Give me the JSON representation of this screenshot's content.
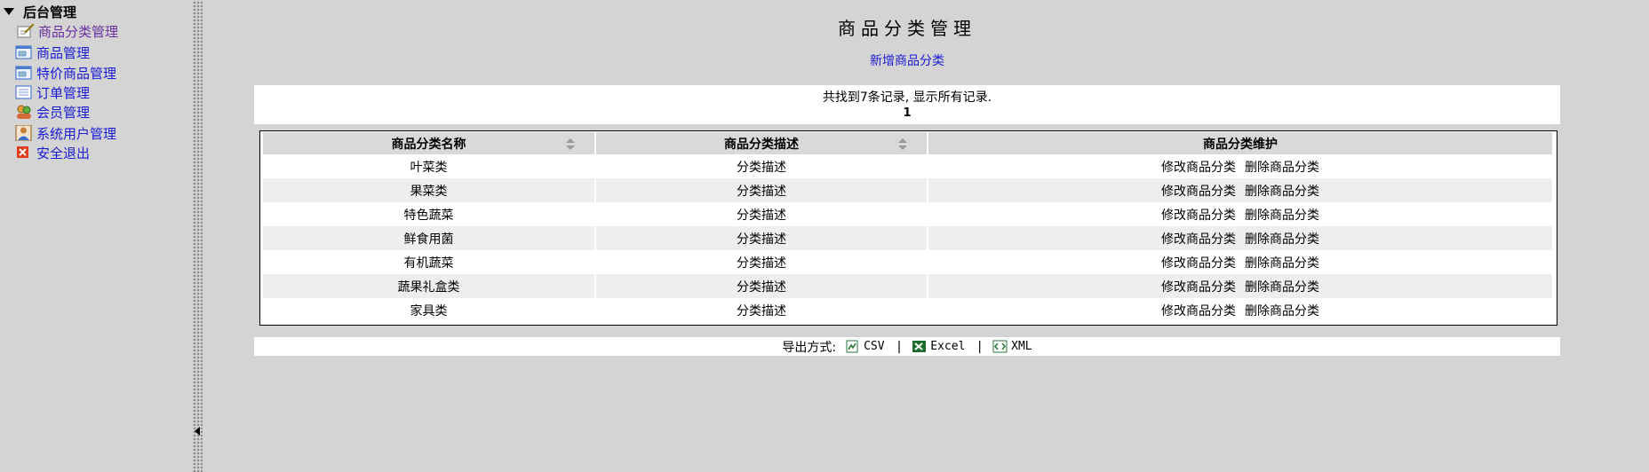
{
  "tree": {
    "root_label": "后台管理",
    "items": [
      {
        "label": "商品分类管理",
        "icon": "edit-note-icon",
        "active": true
      },
      {
        "label": "商品管理",
        "icon": "window-icon",
        "active": false
      },
      {
        "label": "特价商品管理",
        "icon": "window-icon",
        "active": false
      },
      {
        "label": "订单管理",
        "icon": "list-icon",
        "active": false
      },
      {
        "label": "会员管理",
        "icon": "users-icon",
        "active": false
      },
      {
        "label": "系统用户管理",
        "icon": "user-icon",
        "active": false
      },
      {
        "label": "安全退出",
        "icon": "close-icon",
        "active": false
      }
    ]
  },
  "main": {
    "title": "商品分类管理",
    "add_link": "新增商品分类",
    "found_text": "共找到7条记录, 显示所有记录.",
    "page_number": "1"
  },
  "table": {
    "columns": [
      "商品分类名称",
      "商品分类描述",
      "商品分类维护"
    ],
    "rows": [
      {
        "name": "叶菜类",
        "desc": "分类描述"
      },
      {
        "name": "果菜类",
        "desc": "分类描述"
      },
      {
        "name": "特色蔬菜",
        "desc": "分类描述"
      },
      {
        "name": "鲜食用菌",
        "desc": "分类描述"
      },
      {
        "name": "有机蔬菜",
        "desc": "分类描述"
      },
      {
        "name": "蔬果礼盒类",
        "desc": "分类描述"
      },
      {
        "name": "家具类",
        "desc": "分类描述"
      }
    ],
    "edit_label": "修改商品分类",
    "delete_label": "删除商品分类"
  },
  "export": {
    "label": "导出方式:",
    "separator": "|",
    "options": [
      {
        "label": "CSV",
        "icon": "csv-icon"
      },
      {
        "label": "Excel",
        "icon": "excel-icon"
      },
      {
        "label": "XML",
        "icon": "xml-icon"
      }
    ]
  },
  "colors": {
    "background": "#d4d4d4",
    "link": "#1a1ad6",
    "active_link": "#6a2fa0",
    "header_bg": "#d9d9d9",
    "alt_row_bg": "#eeeeee"
  }
}
